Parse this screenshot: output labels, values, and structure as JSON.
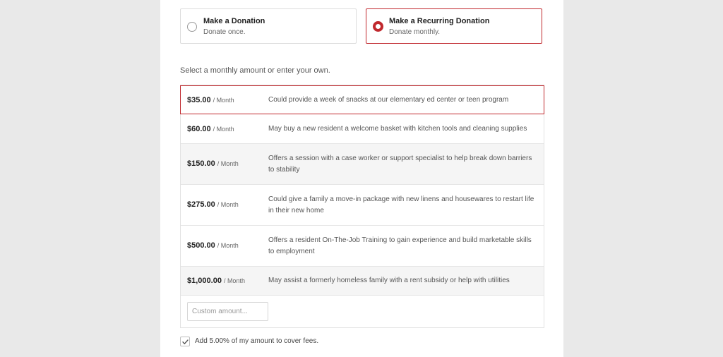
{
  "donation_types": [
    {
      "title": "Make a Donation",
      "subtitle": "Donate once.",
      "selected": false
    },
    {
      "title": "Make a Recurring Donation",
      "subtitle": "Donate monthly.",
      "selected": true
    }
  ],
  "instruction": "Select a monthly amount or enter your own.",
  "amounts": [
    {
      "amount": "$35.00",
      "period": "/ Month",
      "description": "Could provide a week of snacks at our elementary ed center or teen program",
      "selected": true
    },
    {
      "amount": "$60.00",
      "period": "/ Month",
      "description": "May buy a new resident a welcome basket with kitchen tools and cleaning supplies",
      "selected": false
    },
    {
      "amount": "$150.00",
      "period": "/ Month",
      "description": "Offers a session with a case worker or support specialist to help break down barriers to stability",
      "selected": false
    },
    {
      "amount": "$275.00",
      "period": "/ Month",
      "description": "Could give a family a move-in package with new linens and housewares to restart life in their new home",
      "selected": false
    },
    {
      "amount": "$500.00",
      "period": "/ Month",
      "description": "Offers a resident On-The-Job Training to gain experience and build marketable skills to employment",
      "selected": false
    },
    {
      "amount": "$1,000.00",
      "period": "/ Month",
      "description": "May assist a formerly homeless family with a rent subsidy or help with utilities",
      "selected": false
    }
  ],
  "custom_amount": {
    "placeholder": "Custom amount...",
    "value": ""
  },
  "fee_option": {
    "label": "Add 5.00% of my amount to cover fees.",
    "checked": true
  },
  "colors": {
    "accent": "#c0282d",
    "page_background": "#e9e9e9",
    "row_alt": "#f5f5f5"
  }
}
